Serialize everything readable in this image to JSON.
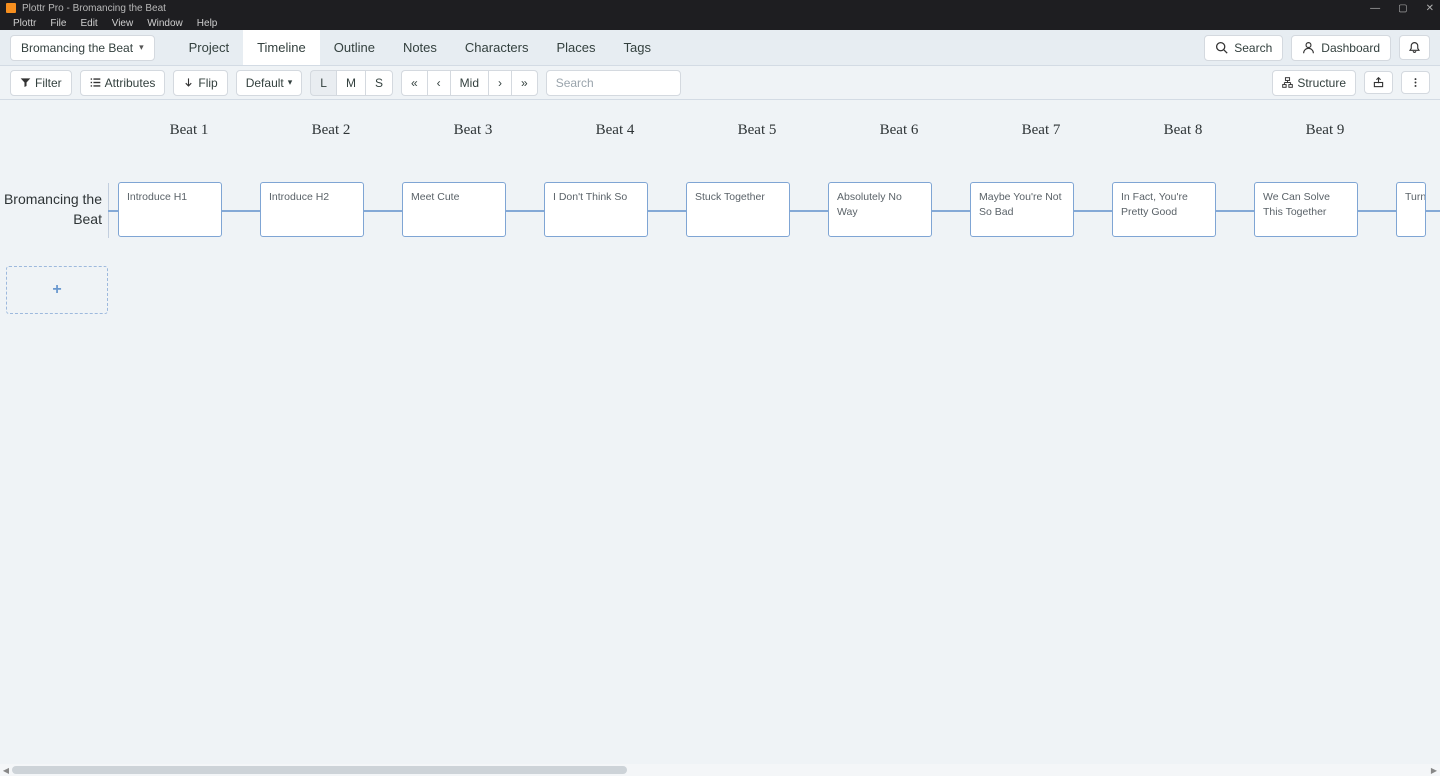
{
  "window": {
    "title": "Plottr Pro - Bromancing the Beat",
    "menus": [
      "Plottr",
      "File",
      "Edit",
      "View",
      "Window",
      "Help"
    ]
  },
  "nav": {
    "file_button": "Bromancing the Beat",
    "tabs": [
      "Project",
      "Timeline",
      "Outline",
      "Notes",
      "Characters",
      "Places",
      "Tags"
    ],
    "active_tab": "Timeline",
    "search_label": "Search",
    "dashboard_label": "Dashboard"
  },
  "toolbar": {
    "filter": "Filter",
    "attributes": "Attributes",
    "flip": "Flip",
    "default": "Default",
    "zoom": {
      "l": "L",
      "m": "M",
      "s": "S",
      "active": "L"
    },
    "nav": {
      "first": "«",
      "prev": "‹",
      "mid": "Mid",
      "next": "›",
      "last": "»"
    },
    "search_placeholder": "Search",
    "structure": "Structure"
  },
  "timeline": {
    "plotline_name": "Bromancing the Beat",
    "beats": [
      "Beat 1",
      "Beat 2",
      "Beat 3",
      "Beat 4",
      "Beat 5",
      "Beat 6",
      "Beat 7",
      "Beat 8",
      "Beat 9"
    ],
    "cards": [
      "Introduce H1",
      "Introduce H2",
      "Meet Cute",
      "I Don't Think So",
      "Stuck Together",
      "Absolutely No Way",
      "Maybe You're Not So Bad",
      "In Fact, You're Pretty Good",
      "We Can Solve This Together",
      "Turn"
    ],
    "add_icon": "+"
  }
}
